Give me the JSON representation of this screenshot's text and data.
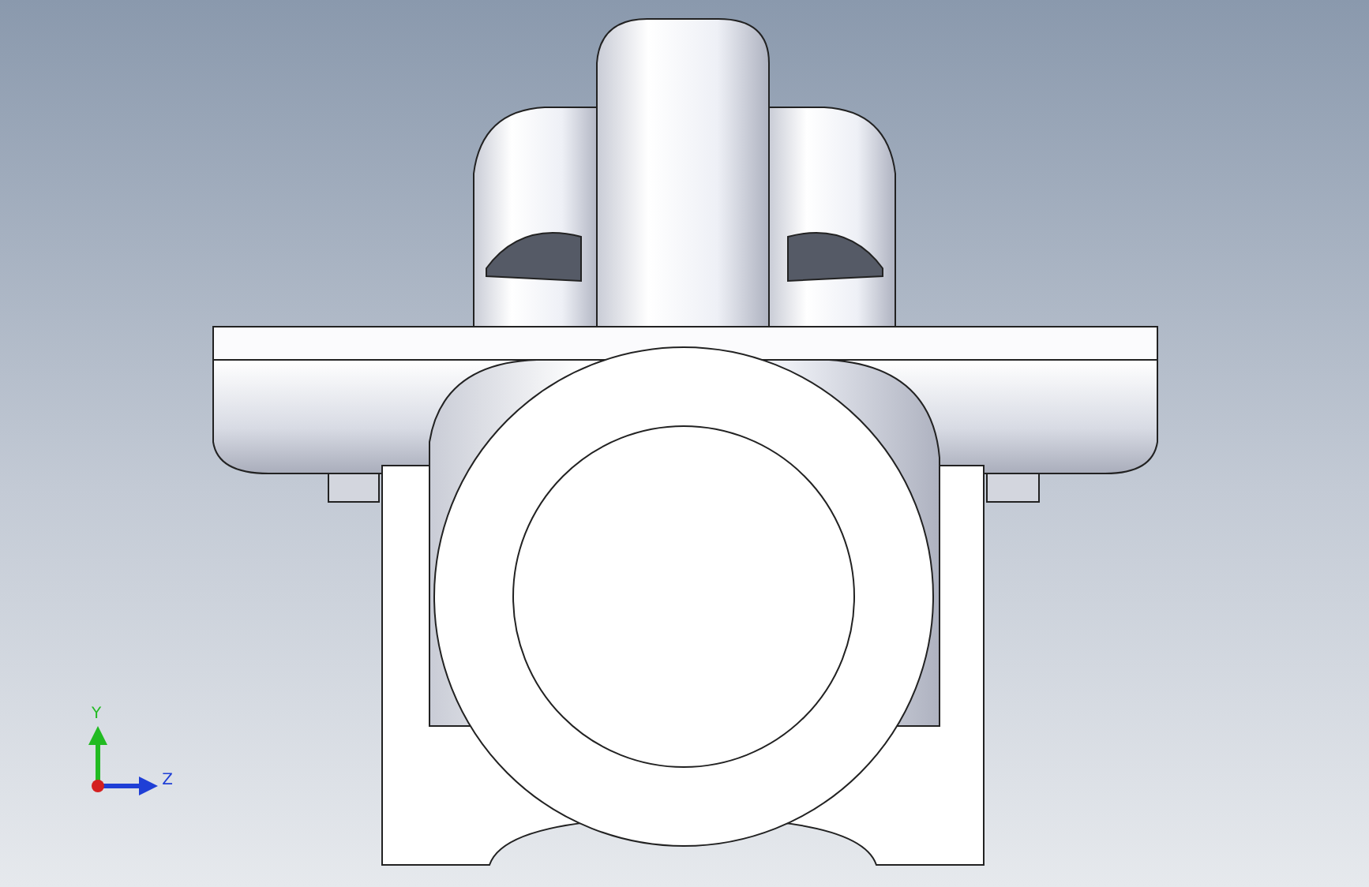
{
  "viewport": {
    "triad": {
      "axes": [
        {
          "label": "Y",
          "kind": "vertical",
          "color": "#22bb22"
        },
        {
          "label": "Z",
          "kind": "horizontal",
          "color": "#1f3fd6"
        }
      ]
    }
  }
}
